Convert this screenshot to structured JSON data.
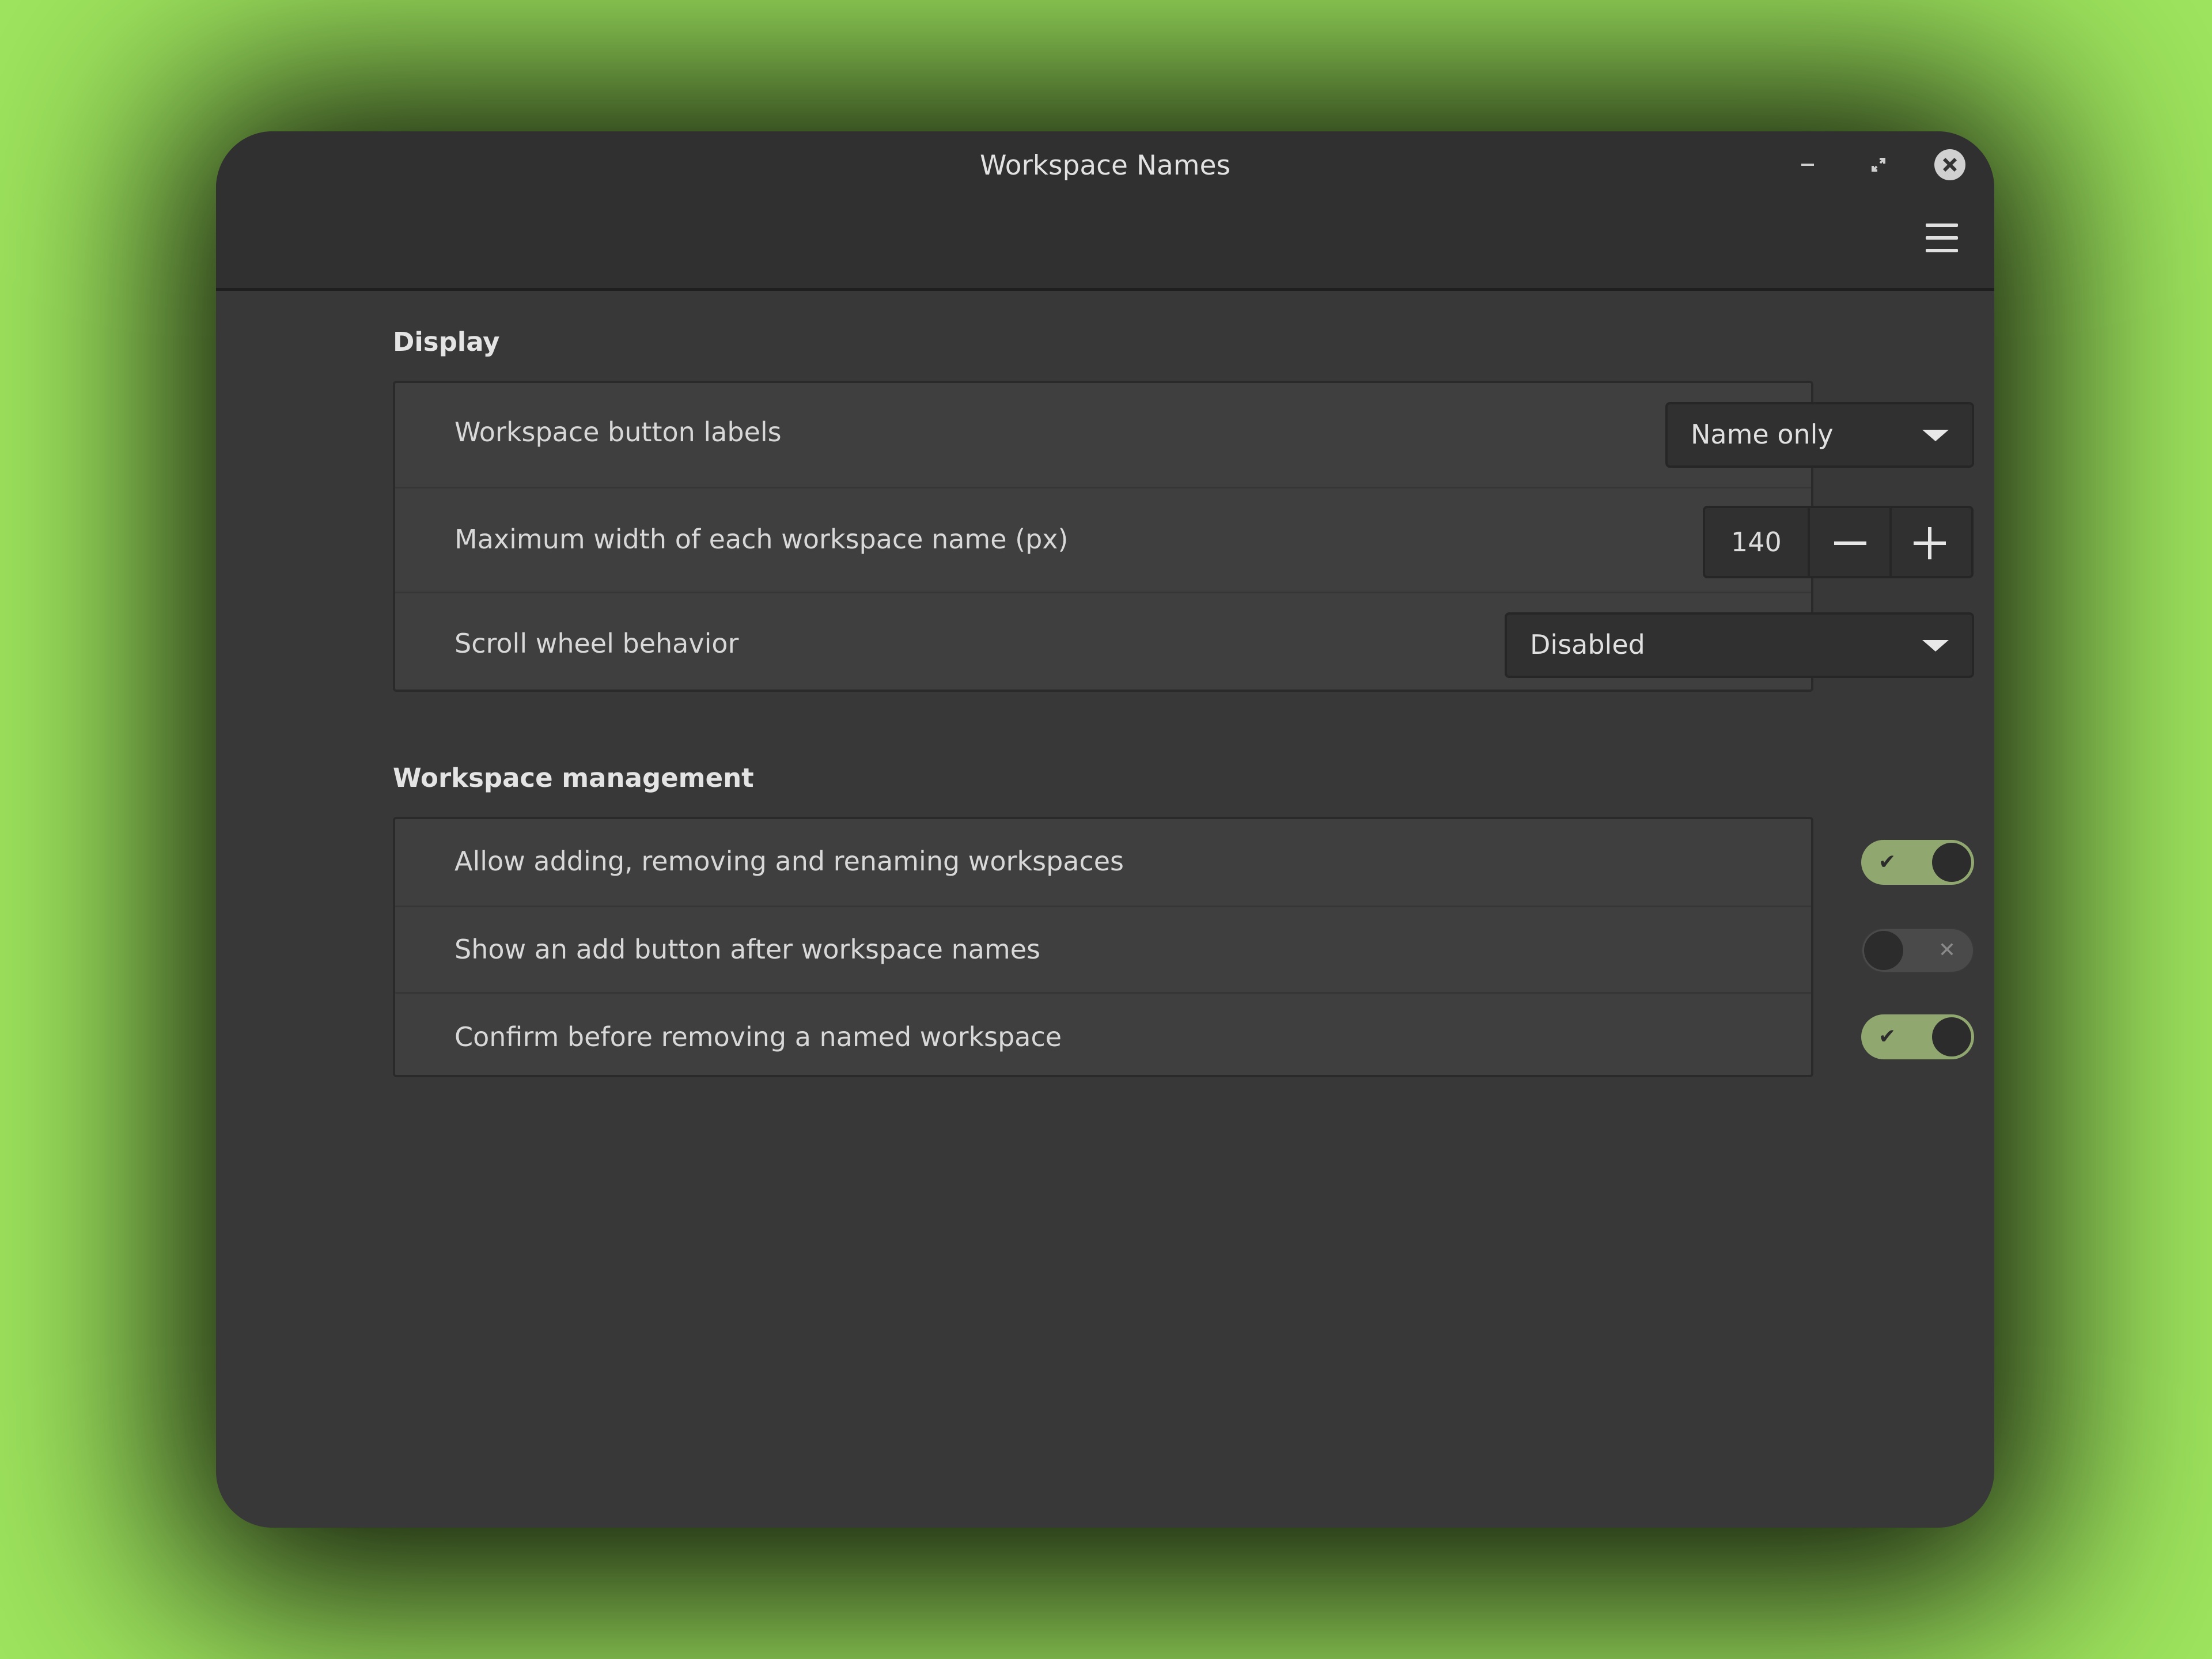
{
  "window": {
    "title": "Workspace Names"
  },
  "sections": {
    "display": {
      "title": "Display",
      "button_labels": {
        "label": "Workspace button labels",
        "value": "Name only"
      },
      "max_width": {
        "label": "Maximum width of each workspace name (px)",
        "value": "140"
      },
      "scroll_wheel": {
        "label": "Scroll wheel behavior",
        "value": "Disabled"
      }
    },
    "management": {
      "title": "Workspace management",
      "allow_editing": {
        "label": "Allow adding, removing and renaming workspaces",
        "enabled": true
      },
      "show_add_button": {
        "label": "Show an add button after workspace names",
        "enabled": false
      },
      "confirm_remove": {
        "label": "Confirm before removing a named workspace",
        "enabled": true
      }
    }
  },
  "icons": {
    "minimize": "minimize-icon",
    "maximize": "maximize-icon",
    "close": "close-icon",
    "menu": "hamburger-menu-icon",
    "check": "✔",
    "cross": "✕"
  },
  "colors": {
    "background": "#9de35d",
    "window": "#383838",
    "titlebar": "#303030",
    "switch_on": "#90a86f",
    "switch_off": "#4a4a4a"
  }
}
